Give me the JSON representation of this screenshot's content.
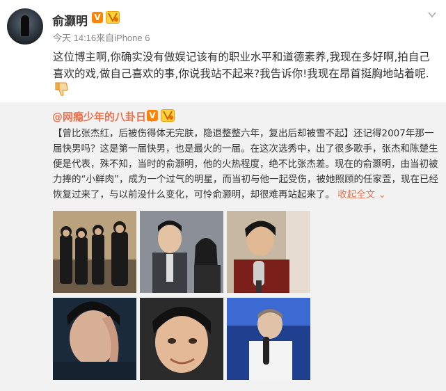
{
  "post": {
    "author": "俞灏明",
    "verified_badge": "V",
    "level_badge": "V6",
    "meta": "今天 14:16来自iPhone 6",
    "text": "这位博主啊,你确实没有做娱记该有的职业水平和道德素养,我现在多好啊,拍自己喜欢的戏,做自己喜欢的事,你说我站不起来?我告诉你!我现在昂首挺胸地站着呢.",
    "emoji": "thumbs-down-icon"
  },
  "repost": {
    "author": "@网瘾少年的八卦日常",
    "verified_badge": "V",
    "level_badge": "V6",
    "text": "【曾比张杰红，后被伤得体无完肤，隐退整整六年，复出后却被雪不起】还记得2007年那一届快男吗？这是第一届快男，也是最火的一届。在这次选秀中，出了很多歌手，张杰和陈楚生便是代表，殊不知，当时的俞灏明，他的火热程度，绝不比张杰差。现在的俞灏明，由当初被力捧的“小鲜肉”，成为一个过气的明星，而当初与他一起受伤，被她照顾的任家萱，现在已经恢复过来了，与以前没什么变化，可怜俞灏明，却很难再站起来了。",
    "expand_label": "收起全文 ⌄",
    "photos": [
      "photo-group-portrait",
      "photo-suit-portrait",
      "photo-interview-mic",
      "photo-scar-closeup",
      "photo-face-closeup",
      "photo-stage-mic"
    ]
  },
  "colors": {
    "accent": "#eb7350",
    "verified": "#ff8200",
    "repost_bg": "#f2f2f2"
  }
}
